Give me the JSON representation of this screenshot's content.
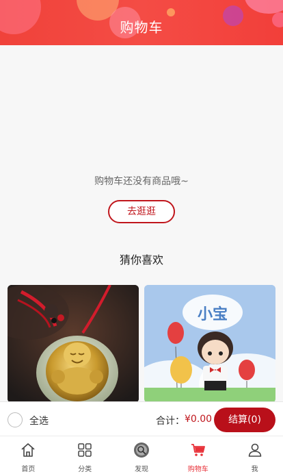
{
  "header": {
    "title": "购物车"
  },
  "colors": {
    "accent": "#c0161c",
    "header_bg": "#f0423a",
    "active_tab": "#e8323a"
  },
  "empty": {
    "message": "购物车还没有商品哦~",
    "browse_label": "去逛逛"
  },
  "recommend": {
    "title": "猜你喜欢",
    "products": [
      {
        "image": "golden-buddha-jade-pendant"
      },
      {
        "image": "xiaobao-cartoon-boy-figure",
        "badge": "小宝"
      }
    ]
  },
  "checkout": {
    "select_all_label": "全选",
    "total_label": "合计：",
    "total_value": "¥0.00",
    "settle_label": "结算(0)"
  },
  "tabbar": {
    "items": [
      {
        "label": "首页",
        "icon": "home-icon"
      },
      {
        "label": "分类",
        "icon": "category-grid-icon"
      },
      {
        "label": "发现",
        "icon": "discover-icon"
      },
      {
        "label": "购物车",
        "icon": "cart-icon",
        "active": true
      },
      {
        "label": "我",
        "icon": "user-icon"
      }
    ]
  }
}
